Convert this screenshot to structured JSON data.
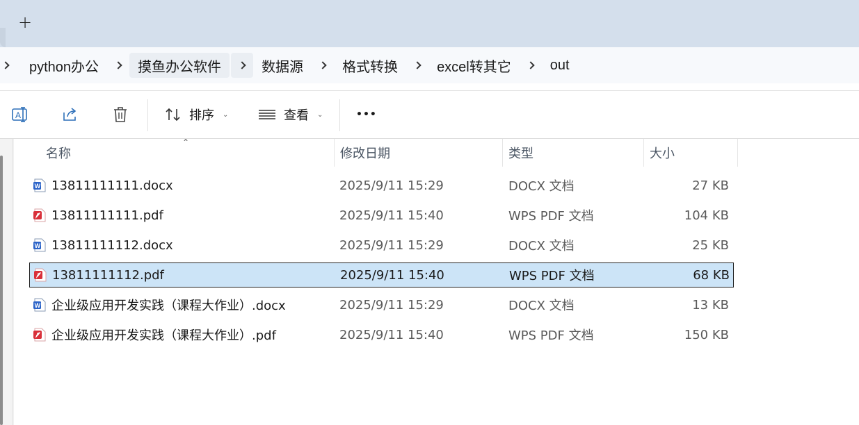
{
  "tabbar": {
    "new_tab_label": "+"
  },
  "breadcrumb": {
    "items": [
      "python办公",
      "摸鱼办公软件",
      "数据源",
      "格式转换",
      "excel转其它",
      "out"
    ]
  },
  "toolbar": {
    "rename_icon": "rename-icon",
    "share_icon": "share-icon",
    "delete_icon": "trash-icon",
    "sort_label": "排序",
    "view_label": "查看",
    "more_label": "•••"
  },
  "columns": {
    "name": "名称",
    "date": "修改日期",
    "type": "类型",
    "size": "大小"
  },
  "files": [
    {
      "name": "13811111111.docx",
      "date": "2025/9/11 15:29",
      "type": "DOCX 文档",
      "size": "27 KB",
      "kind": "word"
    },
    {
      "name": "13811111111.pdf",
      "date": "2025/9/11 15:40",
      "type": "WPS PDF 文档",
      "size": "104 KB",
      "kind": "pdf"
    },
    {
      "name": "13811111112.docx",
      "date": "2025/9/11 15:29",
      "type": "DOCX 文档",
      "size": "25 KB",
      "kind": "word"
    },
    {
      "name": "13811111112.pdf",
      "date": "2025/9/11 15:40",
      "type": "WPS PDF 文档",
      "size": "68 KB",
      "kind": "pdf",
      "selected": true
    },
    {
      "name": "企业级应用开发实践（课程大作业）.docx",
      "date": "2025/9/11 15:29",
      "type": "DOCX 文档",
      "size": "13 KB",
      "kind": "word"
    },
    {
      "name": "企业级应用开发实践（课程大作业）.pdf",
      "date": "2025/9/11 15:40",
      "type": "WPS PDF 文档",
      "size": "150 KB",
      "kind": "pdf"
    }
  ],
  "colors": {
    "selection": "#cce4f7",
    "word_icon": "#2b63c8",
    "pdf_icon": "#d9303a"
  }
}
